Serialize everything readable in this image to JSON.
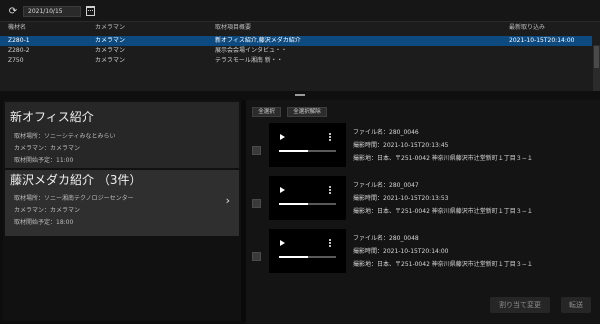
{
  "toolbar": {
    "date_value": "2021/10/15"
  },
  "table": {
    "headers": [
      "機材名",
      "カメラマン",
      "取材項目概要",
      "最新取り込み"
    ],
    "rows": [
      {
        "device": "Z280-1",
        "cameraman": "カメラマン",
        "summary": "新オフィス紹介,藤沢メダカ紹介",
        "latest": "2021-10-15T20:14:00",
        "selected": true
      },
      {
        "device": "Z280-2",
        "cameraman": "カメラマン",
        "summary": "展示会会場インタビュ・・",
        "latest": "",
        "selected": false
      },
      {
        "device": "Z750",
        "cameraman": "カメラマン",
        "summary": "テラスモール湘南 新・・",
        "latest": "",
        "selected": false
      }
    ]
  },
  "stories": [
    {
      "title": "新オフィス紹介",
      "location": "取材場所：ソニーシティみなとみらい",
      "cameraman": "カメラマン：カメラマン",
      "start": "取材開始予定：11:00"
    },
    {
      "title": "藤沢メダカ紹介 （3件）",
      "location": "取材場所：ソニー湘南テクノロジーセンター",
      "cameraman": "カメラマン：カメラマン",
      "start": "取材開始予定：18:00"
    }
  ],
  "clip_panel": {
    "select_all_label": "全選択",
    "deselect_all_label": "全選択解除"
  },
  "clips": [
    {
      "filename": "ファイル名：280_0046",
      "shot_time": "撮影時間：2021-10-15T20:13:45",
      "shot_place": "撮影地：日本、〒251-0042 神奈川県藤沢市辻堂新町１丁目３−１",
      "progress": 0.5
    },
    {
      "filename": "ファイル名：280_0047",
      "shot_time": "撮影時間：2021-10-15T20:13:53",
      "shot_place": "撮影地：日本、〒251-0042 神奈川県藤沢市辻堂新町１丁目３−１",
      "progress": 0.5
    },
    {
      "filename": "ファイル名：280_0048",
      "shot_time": "撮影時間：2021-10-15T20:14:00",
      "shot_place": "撮影地：日本、〒251-0042 神奈川県藤沢市辻堂新町１丁目３−１",
      "progress": 0.5
    }
  ],
  "footer": {
    "reassign_label": "割り当て変更",
    "transfer_label": "転送"
  },
  "icons": {
    "refresh": "refresh-icon",
    "calendar": "calendar-icon",
    "play": "play-icon",
    "menu": "more-vertical-icon",
    "chevron": "chevron-right-icon"
  },
  "colors": {
    "selection": "#0c4a80",
    "background": "#0d0d0d"
  }
}
